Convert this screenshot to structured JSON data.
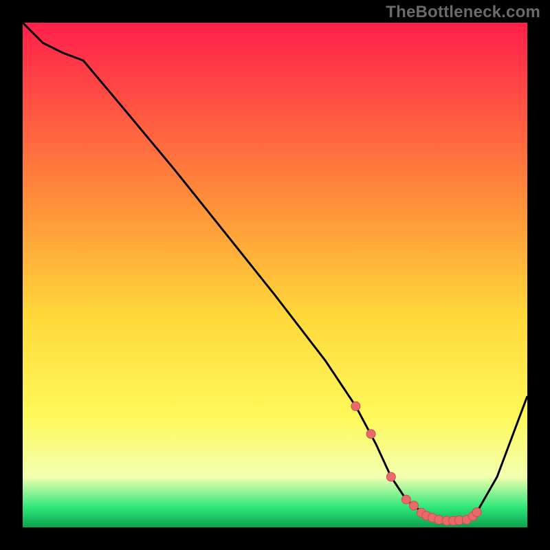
{
  "watermark_text": "TheBottleneck.com",
  "colors": {
    "frame_bg": "#000000",
    "watermark": "#6a6a6a",
    "line": "#000000",
    "marker_fill": "#e86a6a",
    "marker_stroke": "#c94f4f",
    "grad_top": "#ff1f4b",
    "grad_mid_upper": "#ff8a3a",
    "grad_mid": "#ffd83a",
    "grad_mid_lower": "#fff95a",
    "grad_pale": "#f2ffb0",
    "grad_green": "#2fe87a",
    "grad_bottom": "#0aa24e"
  },
  "chart_data": {
    "type": "line",
    "title": "",
    "xlabel": "",
    "ylabel": "",
    "xlim": [
      0,
      100
    ],
    "ylim": [
      0,
      100
    ],
    "grid": false,
    "series": [
      {
        "name": "curve",
        "x": [
          0,
          4,
          8,
          12,
          20,
          30,
          40,
          50,
          60,
          66,
          70,
          73,
          76,
          80,
          84,
          88,
          90,
          94,
          100
        ],
        "y": [
          100,
          96,
          94,
          92.5,
          83,
          71,
          58.5,
          46,
          33,
          24,
          16.5,
          10,
          5.5,
          2.3,
          1.3,
          1.5,
          3,
          10,
          26
        ]
      }
    ],
    "markers": {
      "name": "highlight-points",
      "x": [
        66,
        69,
        73,
        76,
        77.5,
        79,
        80,
        81.2,
        82.5,
        84,
        85.3,
        86.5,
        88,
        89.2,
        90
      ],
      "y": [
        24,
        18.5,
        10,
        5.5,
        4.3,
        2.9,
        2.3,
        1.9,
        1.5,
        1.3,
        1.3,
        1.4,
        1.5,
        2.2,
        3
      ]
    }
  }
}
